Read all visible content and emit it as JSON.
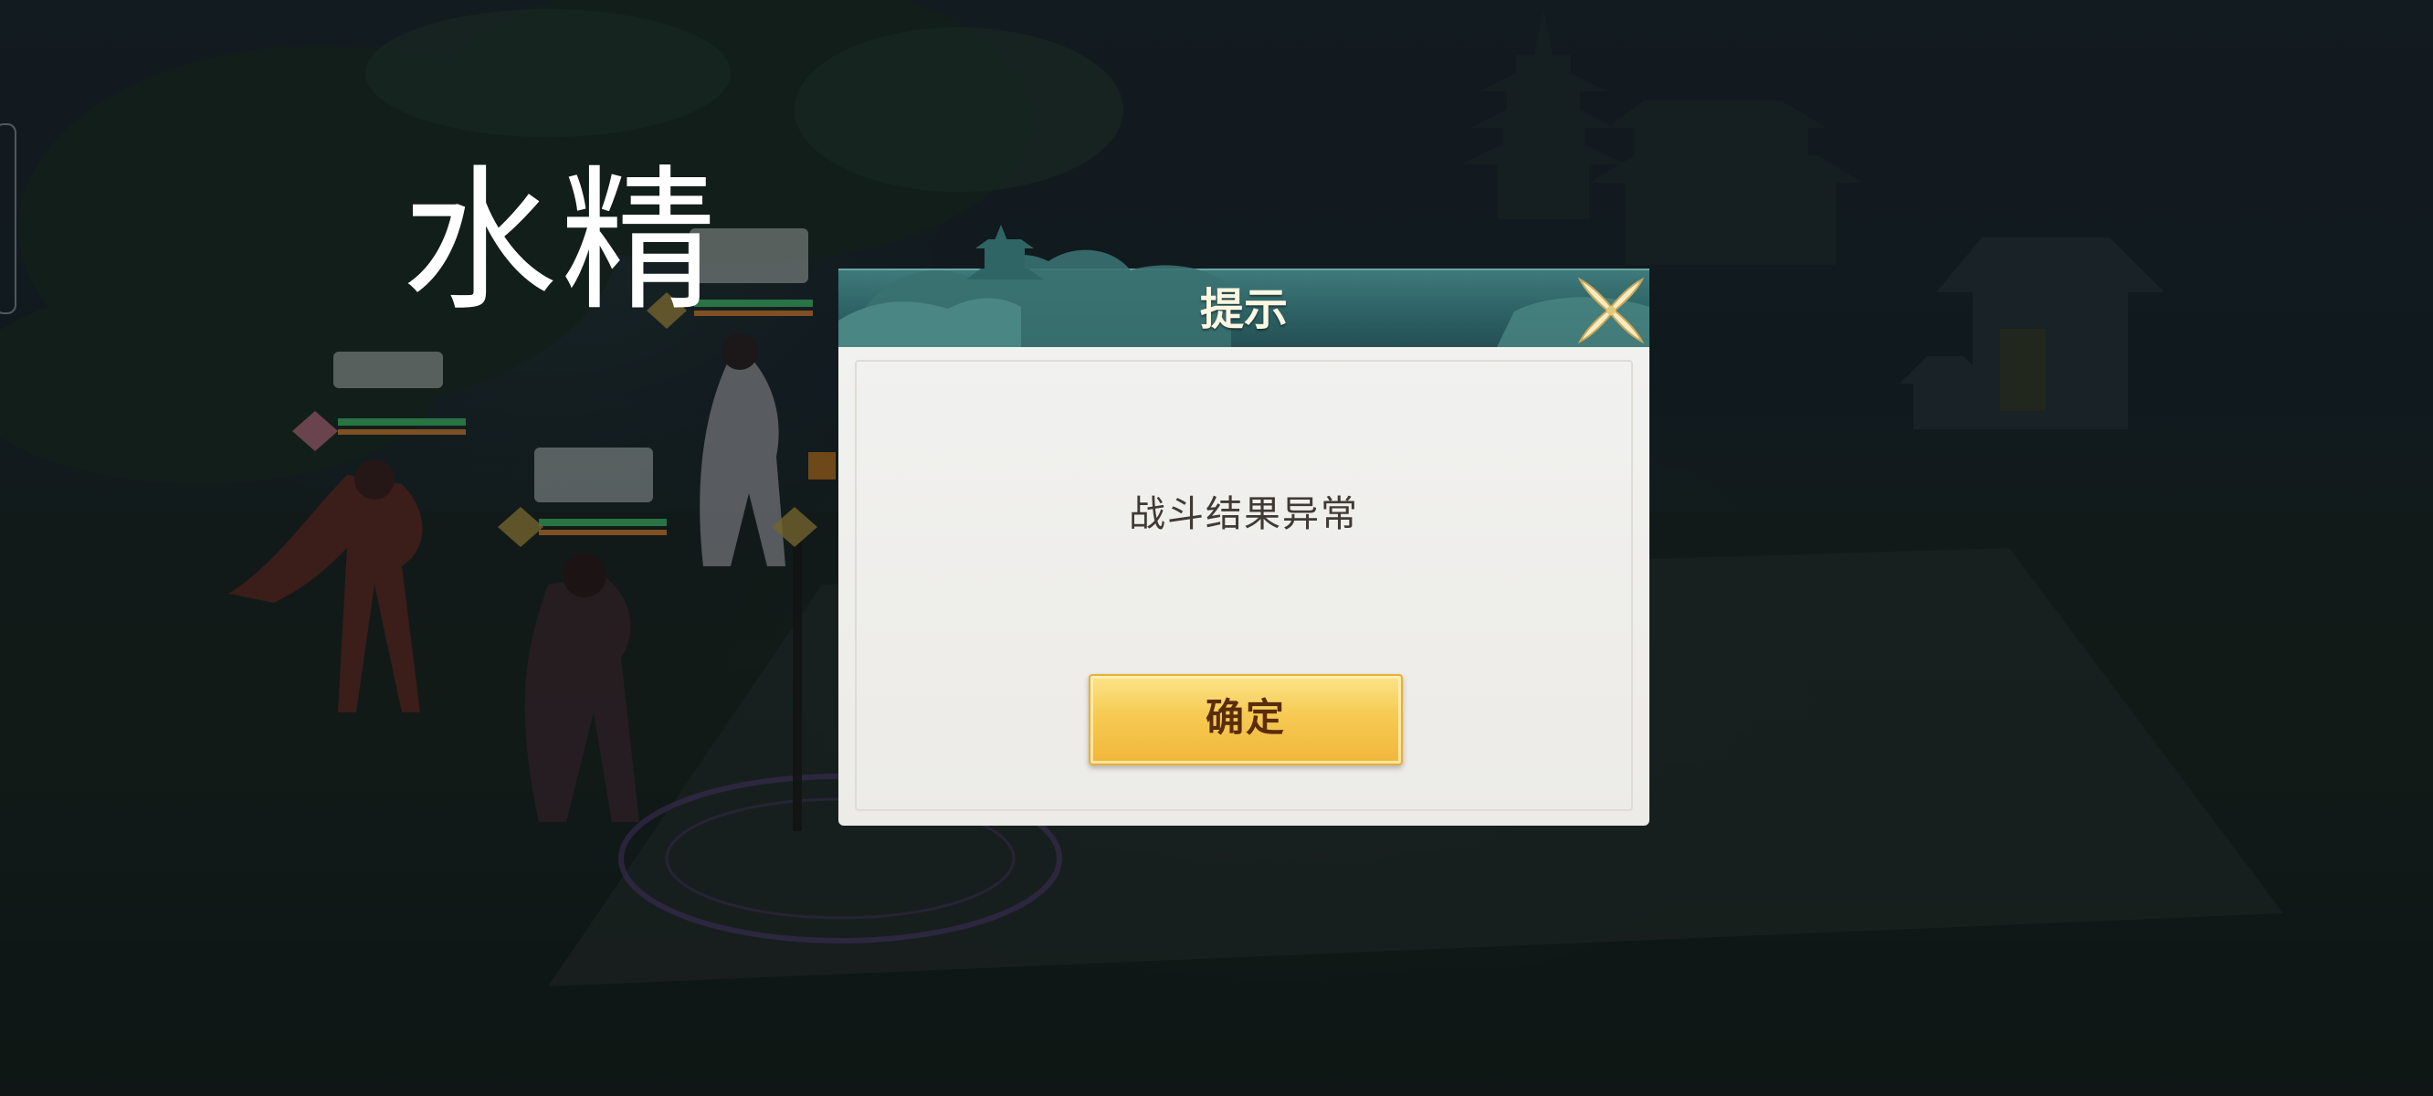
{
  "scene": {
    "boss_name": "水精"
  },
  "dialog": {
    "title": "提示",
    "message": "战斗结果异常",
    "confirm_label": "确定",
    "close_icon": "close-x-icon"
  },
  "colors": {
    "header_teal": "#2b5f62",
    "button_gold": "#f6ca52",
    "button_text": "#5a2c0c",
    "message_text": "#3f3a33"
  }
}
